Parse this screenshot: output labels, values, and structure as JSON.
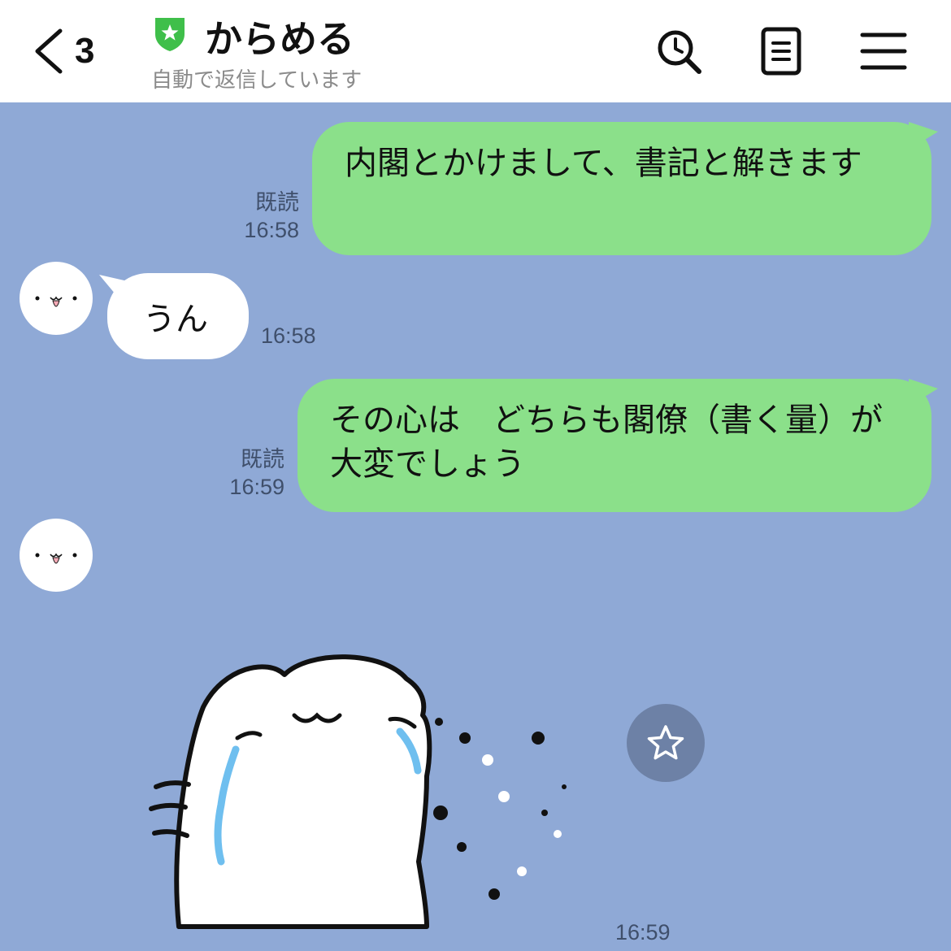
{
  "header": {
    "back_count": "3",
    "chat_title": "からめる",
    "status": "自動で返信しています",
    "shield_color": "#3fbf4a",
    "icons": [
      "search-history-icon",
      "notes-icon",
      "menu-icon"
    ]
  },
  "messages": [
    {
      "sender": "me",
      "text": "内閣とかけまして、書記と解きます",
      "read": "既読",
      "time": "16:58"
    },
    {
      "sender": "bot",
      "text": "うん",
      "time": "16:58"
    },
    {
      "sender": "me",
      "text": "その心は　どちらも閣僚（書く量）が大変でしょう",
      "read": "既読",
      "time": "16:59"
    },
    {
      "sender": "bot",
      "type": "sticker",
      "sticker_icon": "crying-cat-sticker",
      "time": "16:59"
    }
  ],
  "colors": {
    "chat_background": "#8fa9d6",
    "sent_bubble": "#8be08a",
    "received_bubble": "#ffffff"
  }
}
